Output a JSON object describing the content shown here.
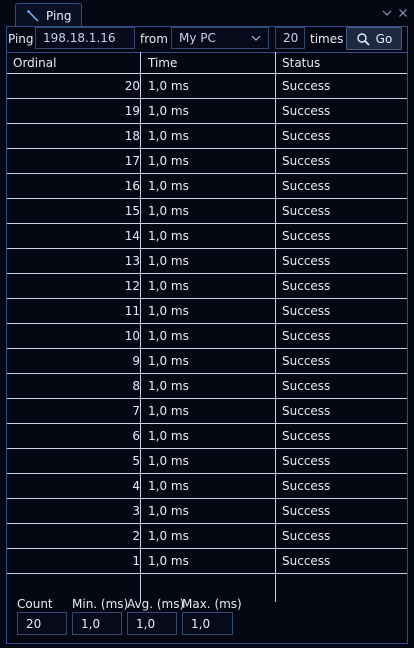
{
  "tab": {
    "label": "Ping",
    "icon": "ping-icon"
  },
  "window_controls": {
    "icons": [
      "chevron-down-icon",
      "close-icon"
    ]
  },
  "toolbar": {
    "ping_label": "Ping",
    "host_value": "198.18.1.16",
    "from_label": "from",
    "source_value": "My PC",
    "count_value": "20",
    "times_label": "times",
    "go_label": "Go",
    "go_icon": "search-icon"
  },
  "table": {
    "columns": [
      "Ordinal",
      "Time",
      "Status"
    ],
    "rows": [
      {
        "ordinal": "20",
        "time": "1,0 ms",
        "status": "Success"
      },
      {
        "ordinal": "19",
        "time": "1,0 ms",
        "status": "Success"
      },
      {
        "ordinal": "18",
        "time": "1,0 ms",
        "status": "Success"
      },
      {
        "ordinal": "17",
        "time": "1,0 ms",
        "status": "Success"
      },
      {
        "ordinal": "16",
        "time": "1,0 ms",
        "status": "Success"
      },
      {
        "ordinal": "15",
        "time": "1,0 ms",
        "status": "Success"
      },
      {
        "ordinal": "14",
        "time": "1,0 ms",
        "status": "Success"
      },
      {
        "ordinal": "13",
        "time": "1,0 ms",
        "status": "Success"
      },
      {
        "ordinal": "12",
        "time": "1,0 ms",
        "status": "Success"
      },
      {
        "ordinal": "11",
        "time": "1,0 ms",
        "status": "Success"
      },
      {
        "ordinal": "10",
        "time": "1,0 ms",
        "status": "Success"
      },
      {
        "ordinal": "9",
        "time": "1,0 ms",
        "status": "Success"
      },
      {
        "ordinal": "8",
        "time": "1,0 ms",
        "status": "Success"
      },
      {
        "ordinal": "7",
        "time": "1,0 ms",
        "status": "Success"
      },
      {
        "ordinal": "6",
        "time": "1,0 ms",
        "status": "Success"
      },
      {
        "ordinal": "5",
        "time": "1,0 ms",
        "status": "Success"
      },
      {
        "ordinal": "4",
        "time": "1,0 ms",
        "status": "Success"
      },
      {
        "ordinal": "3",
        "time": "1,0 ms",
        "status": "Success"
      },
      {
        "ordinal": "2",
        "time": "1,0 ms",
        "status": "Success"
      },
      {
        "ordinal": "1",
        "time": "1,0 ms",
        "status": "Success"
      }
    ]
  },
  "stats": {
    "count_label": "Count",
    "count_value": "20",
    "min_label": "Min. (ms)",
    "min_value": "1,0",
    "avg_label": "Avg. (ms)",
    "avg_value": "1,0",
    "max_label": "Max. (ms)",
    "max_value": "1,0"
  },
  "colors": {
    "background": "#050713",
    "border": "#2f4f86",
    "grid": "#c9d2e6",
    "text": "#e8ecf5",
    "button": "#1c2940"
  }
}
